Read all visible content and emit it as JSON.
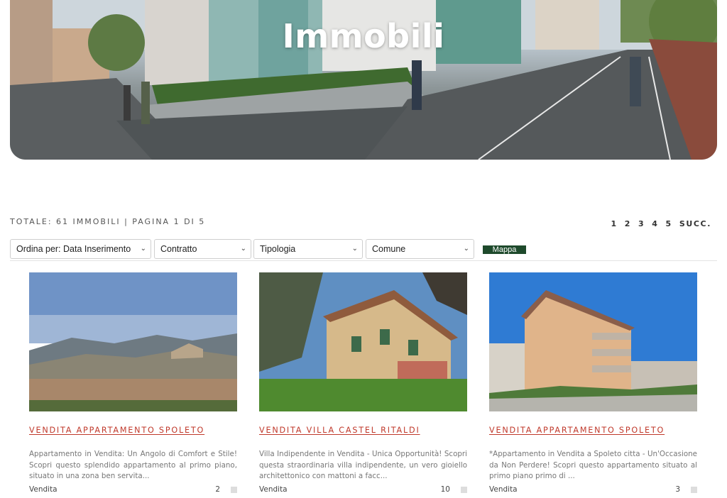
{
  "hero": {
    "title": "Immobili"
  },
  "listing": {
    "totals": "TOTALE: 61 IMMOBILI | PAGINA 1 DI 5",
    "pages": [
      "1",
      "2",
      "3",
      "4",
      "5"
    ],
    "next_label": "SUCC."
  },
  "filters": {
    "sort": "Ordina per: Data Inserimento",
    "contract": "Contratto",
    "type": "Tipologia",
    "town": "Comune",
    "map_label": "Mappa"
  },
  "cards": [
    {
      "title": "VENDITA APPARTAMENTO SPOLETO",
      "description": "Appartamento in Vendita: Un Angolo di Comfort e Stile! Scopri questo splendido appartamento al primo piano, situato in una zona ben servita...",
      "contract": "Vendita",
      "photos": "2"
    },
    {
      "title": "VENDITA VILLA CASTEL RITALDI",
      "description": "Villa Indipendente in Vendita - Unica Opportunità! Scopri questa straordinaria villa indipendente, un vero gioiello architettonico con mattoni a facc...",
      "contract": "Vendita",
      "photos": "10"
    },
    {
      "title": "VENDITA APPARTAMENTO SPOLETO",
      "description": "*Appartamento in Vendita a Spoleto citta - Un'Occasione da Non Perdere! Scopri questo appartamento situato al primo piano primo di ...",
      "contract": "Vendita",
      "photos": "3"
    }
  ],
  "colors": {
    "accent": "#c0392b",
    "map_button": "#1e4a2c"
  }
}
